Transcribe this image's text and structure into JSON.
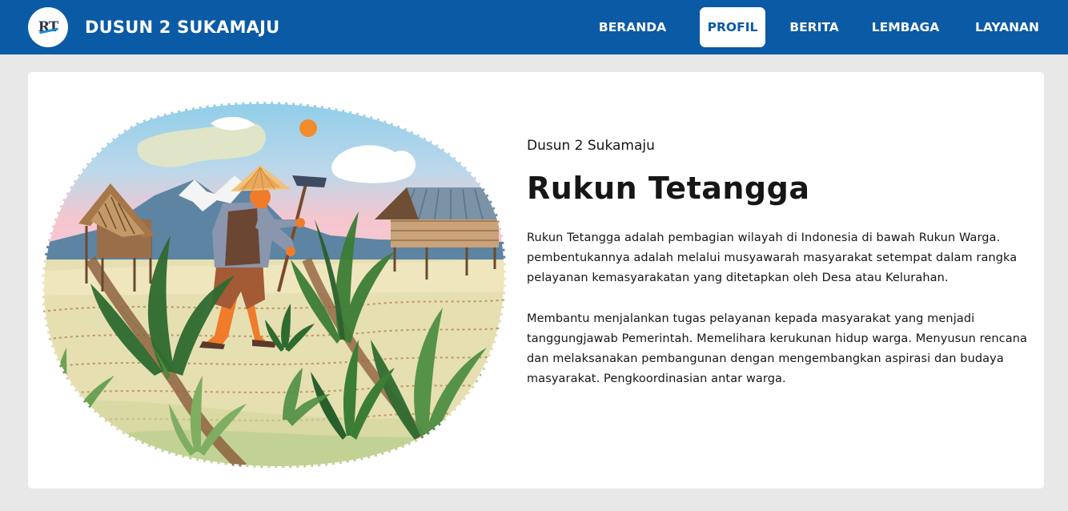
{
  "brand": {
    "logo_text": "RT",
    "title": "DUSUN 2 SUKAMAJU"
  },
  "nav": {
    "items": [
      {
        "label": "BERANDA",
        "active": false
      },
      {
        "label": "PROFIL",
        "active": true
      },
      {
        "label": "BERITA",
        "active": false
      },
      {
        "label": "LEMBAGA",
        "active": false
      },
      {
        "label": "LAYANAN",
        "active": false
      }
    ]
  },
  "content": {
    "subtitle": "Dusun 2 Sukamaju",
    "title": "Rukun Tetangga",
    "paragraph1": "Rukun Tetangga adalah pembagian wilayah di Indonesia di bawah Rukun Warga. pembentukannya adalah melalui musyawarah masyarakat setempat dalam rangka pelayanan kemasyarakatan yang ditetapkan oleh Desa atau Kelurahan.",
    "paragraph2": "Membantu menjalankan tugas pelayanan kepada masyarakat yang menjadi tanggungjawab Pemerintah. Memelihara kerukunan hidup warga. Menyusun rencana dan melaksanakan pembangunan dengan mengembangkan aspirasi dan budaya masyarakat. Pengkoordinasian antar warga."
  },
  "colors": {
    "primary": "#0a5aa6",
    "page_bg": "#e8e8e8",
    "card_bg": "#ffffff"
  },
  "illustration": {
    "subject": "farmer-in-rice-field-illustration"
  }
}
